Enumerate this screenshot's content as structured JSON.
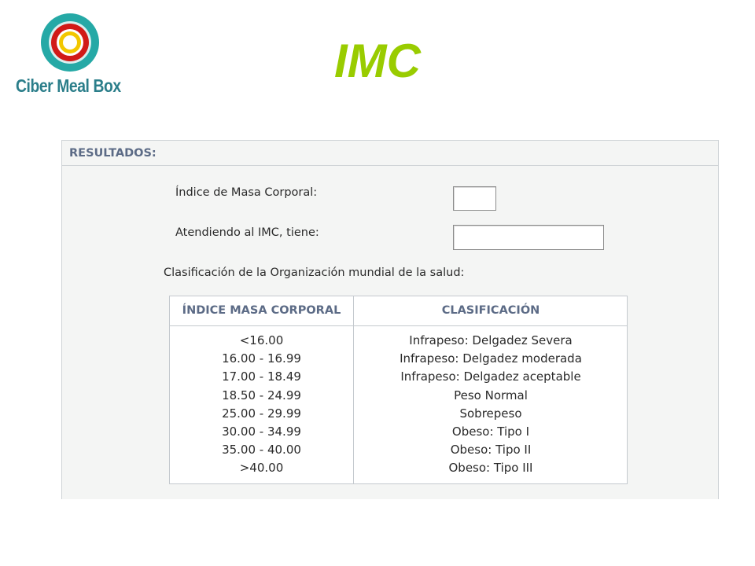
{
  "logo": {
    "text": "Ciber Meal Box",
    "icon": "concentric-rings-logo",
    "colors": {
      "outer": "#25a9a6",
      "middle": "#d11a17",
      "inner": "#f2c700",
      "text": "#2b7e8a"
    }
  },
  "title": "IMC",
  "panel": {
    "header": "RESULTADOS:",
    "bmi_label": "Índice de Masa Corporal:",
    "bmi_value": "",
    "status_label": "Atendiendo al IMC, tiene:",
    "status_value": "",
    "who_label": "Clasificación de la Organización mundial de la salud:"
  },
  "table": {
    "headers": [
      "ÍNDICE MASA CORPORAL",
      "CLASIFICACIÓN"
    ],
    "rows": [
      {
        "range": "<16.00",
        "classification": "Infrapeso: Delgadez Severa"
      },
      {
        "range": "16.00 - 16.99",
        "classification": "Infrapeso: Delgadez moderada"
      },
      {
        "range": "17.00 - 18.49",
        "classification": "Infrapeso: Delgadez aceptable"
      },
      {
        "range": "18.50 - 24.99",
        "classification": "Peso Normal"
      },
      {
        "range": "25.00 - 29.99",
        "classification": "Sobrepeso"
      },
      {
        "range": "30.00 - 34.99",
        "classification": "Obeso: Tipo I"
      },
      {
        "range": "35.00 - 40.00",
        "classification": "Obeso: Tipo II"
      },
      {
        "range": ">40.00",
        "classification": "Obeso: Tipo III"
      }
    ]
  },
  "colors": {
    "title": "#99cc00",
    "header_text": "#5c6b86",
    "panel_bg": "#f4f5f4",
    "border": "#cfd3d6"
  }
}
